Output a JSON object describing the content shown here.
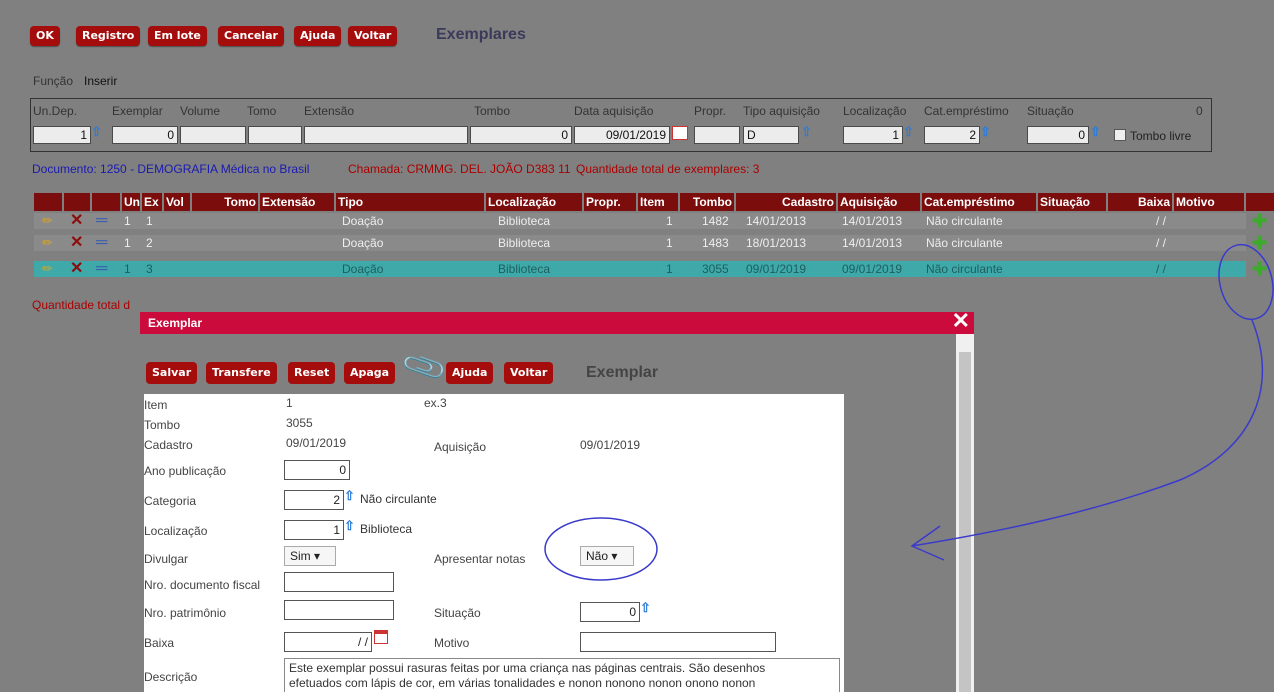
{
  "toolbar": {
    "ok": "OK",
    "registro": "Registro",
    "emlote": "Em lote",
    "cancelar": "Cancelar",
    "ajuda": "Ajuda",
    "voltar": "Voltar"
  },
  "page_title": "Exemplares",
  "funcao": {
    "label": "Função",
    "value": "Inserir"
  },
  "filter": {
    "labels": {
      "undep": "Un.Dep.",
      "exemplar": "Exemplar",
      "volume": "Volume",
      "tomo": "Tomo",
      "extensao": "Extensão",
      "tombo": "Tombo",
      "data_aquisicao": "Data aquisição",
      "propr": "Propr.",
      "tipo_aquisicao": "Tipo aquisição",
      "localizacao": "Localização",
      "cat_emprestimo": "Cat.empréstimo",
      "situacao": "Situação",
      "count": "0"
    },
    "values": {
      "undep": "1",
      "exemplar": "0",
      "tombo": "0",
      "data_aquisicao": "09/01/2019",
      "tipo_aquisicao": "D",
      "localizacao": "1",
      "cat_emprestimo": "2",
      "situacao": "0"
    },
    "tombo_livre": "Tombo livre"
  },
  "info": {
    "documento": "Documento: 1250 - DEMOGRAFIA Médica no Brasil",
    "chamada": "Chamada: CRMMG. DEL. JOÃO D383 11",
    "quantidade": "Quantidade total de exemplares: 3"
  },
  "table": {
    "headers": [
      "Un",
      "Ex",
      "Vol",
      "Tomo",
      "Extensão",
      "Tipo",
      "Localização",
      "Propr.",
      "Item",
      "Tombo",
      "Cadastro",
      "Aquisição",
      "Cat.empréstimo",
      "Situação",
      "Baixa",
      "Motivo"
    ],
    "rows": [
      {
        "un": "1",
        "ex": "1",
        "tipo": "Doação",
        "loc": "Biblioteca",
        "item": "1",
        "tombo": "1482",
        "cadastro": "14/01/2013",
        "aquisicao": "14/01/2013",
        "cat": "Não circulante",
        "baixa": "/ /"
      },
      {
        "un": "1",
        "ex": "2",
        "tipo": "Doação",
        "loc": "Biblioteca",
        "item": "1",
        "tombo": "1483",
        "cadastro": "18/01/2013",
        "aquisicao": "14/01/2013",
        "cat": "Não circulante",
        "baixa": "/ /"
      },
      {
        "un": "1",
        "ex": "3",
        "tipo": "Doação",
        "loc": "Biblioteca",
        "item": "1",
        "tombo": "3055",
        "cadastro": "09/01/2019",
        "aquisicao": "09/01/2019",
        "cat": "Não circulante",
        "baixa": "/ /"
      }
    ]
  },
  "qtd_total_partial": "Quantidade total d",
  "modal": {
    "header": "Exemplar",
    "buttons": {
      "salvar": "Salvar",
      "transfere": "Transfere",
      "reset": "Reset",
      "apaga": "Apaga",
      "ajuda": "Ajuda",
      "voltar": "Voltar"
    },
    "title": "Exemplar",
    "fields": {
      "item_label": "Item",
      "item_value": "1",
      "item_ex": "ex.3",
      "tombo_label": "Tombo",
      "tombo_value": "3055",
      "cadastro_label": "Cadastro",
      "cadastro_value": "09/01/2019",
      "aquisicao_label": "Aquisição",
      "aquisicao_value": "09/01/2019",
      "ano_label": "Ano publicação",
      "ano_value": "0",
      "categoria_label": "Categoria",
      "categoria_value": "2",
      "categoria_text": "Não circulante",
      "localizacao_label": "Localização",
      "localizacao_value": "1",
      "localizacao_text": "Biblioteca",
      "divulgar_label": "Divulgar",
      "divulgar_value": "Sim",
      "apresentar_label": "Apresentar notas",
      "apresentar_value": "Não",
      "nro_doc_label": "Nro. documento fiscal",
      "nro_pat_label": "Nro. patrimônio",
      "situacao_label": "Situação",
      "situacao_value": "0",
      "baixa_label": "Baixa",
      "baixa_value": "/ /",
      "motivo_label": "Motivo",
      "descricao_label": "Descrição",
      "descricao_value": "Este exemplar possui rasuras feitas por uma criança nas páginas centrais. São desenhos efetuados com lápis de cor, em várias tonalidades e nonon nonono nonon onono nonon"
    }
  }
}
